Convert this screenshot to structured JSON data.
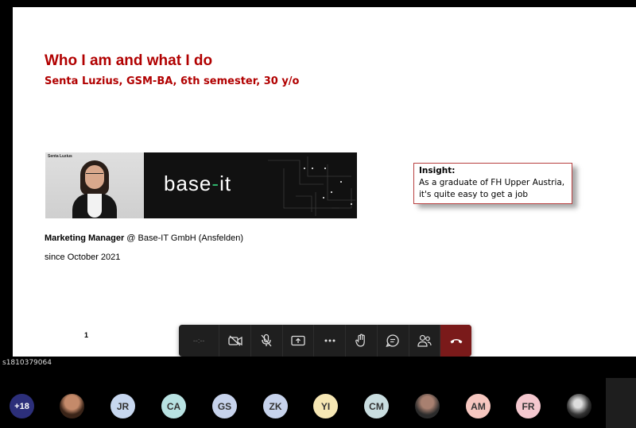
{
  "slide": {
    "title": "Who I am and what I do",
    "subtitle": "Senta Luzius, GSM-BA, 6th semester, 30 y/o",
    "photo_caption": "Senta Luzius",
    "logo_text": "base-it",
    "job_title": "Marketing Manager",
    "job_rest": " @ Base-IT GmbH (Ansfelden)",
    "since": "since October 2021",
    "insight_title": "Insight:",
    "insight_text": "As a graduate of FH Upper Austria, it's quite easy to get a job",
    "page_number": "1",
    "title_color": "#b10000"
  },
  "toolbar": {
    "timer": "--:--",
    "buttons": [
      "camera-off",
      "mic-off",
      "share-screen",
      "more",
      "raise-hand",
      "chat",
      "people",
      "leave"
    ]
  },
  "presenter_tile_label": "s1810379064",
  "attendees": [
    {
      "initials": "+18",
      "color": "#2c2f7a",
      "text_color": "#ffffff"
    },
    {
      "initials": "",
      "photo": true
    },
    {
      "initials": "JR",
      "color": "#c7d7ef"
    },
    {
      "initials": "CA",
      "color": "#b8e2e2"
    },
    {
      "initials": "GS",
      "color": "#c7d3ec"
    },
    {
      "initials": "ZK",
      "color": "#c7d3ec"
    },
    {
      "initials": "YI",
      "color": "#f6e7b4"
    },
    {
      "initials": "CM",
      "color": "#c9dde0"
    },
    {
      "initials": "",
      "photo": true
    },
    {
      "initials": "AM",
      "color": "#f6c7c0"
    },
    {
      "initials": "FR",
      "color": "#f4c8cf"
    },
    {
      "initials": "",
      "photo": true
    }
  ]
}
